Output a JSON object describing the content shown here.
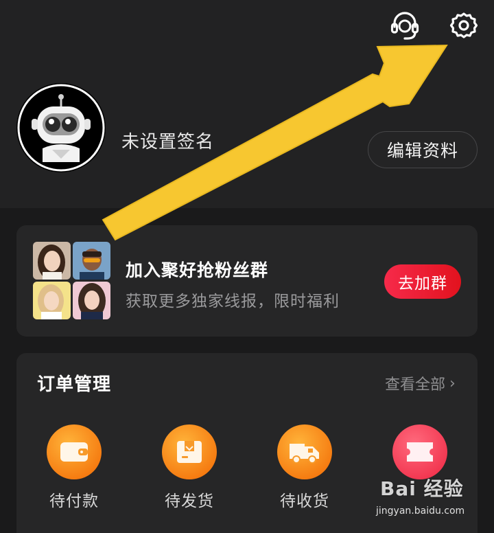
{
  "header": {
    "icons": [
      "customer-service-icon",
      "settings-icon"
    ]
  },
  "profile": {
    "signature": "未设置签名",
    "edit_label": "编辑资料"
  },
  "fan_group": {
    "title": "加入聚好抢粉丝群",
    "subtitle": "获取更多独家线报，限时福利",
    "join_label": "去加群"
  },
  "orders": {
    "title": "订单管理",
    "view_all": "查看全部",
    "items": [
      {
        "label": "待付款",
        "icon": "wallet-icon"
      },
      {
        "label": "待发货",
        "icon": "package-icon"
      },
      {
        "label": "待收货",
        "icon": "truck-icon"
      },
      {
        "label": "",
        "icon": "ticket-icon"
      }
    ]
  },
  "watermark": {
    "brand": "Bai 经验",
    "url": "jingyan.baidu.com"
  },
  "colors": {
    "accent_orange": "#f68a1a",
    "accent_red": "#f23650",
    "annotation_arrow": "#f7c730"
  }
}
